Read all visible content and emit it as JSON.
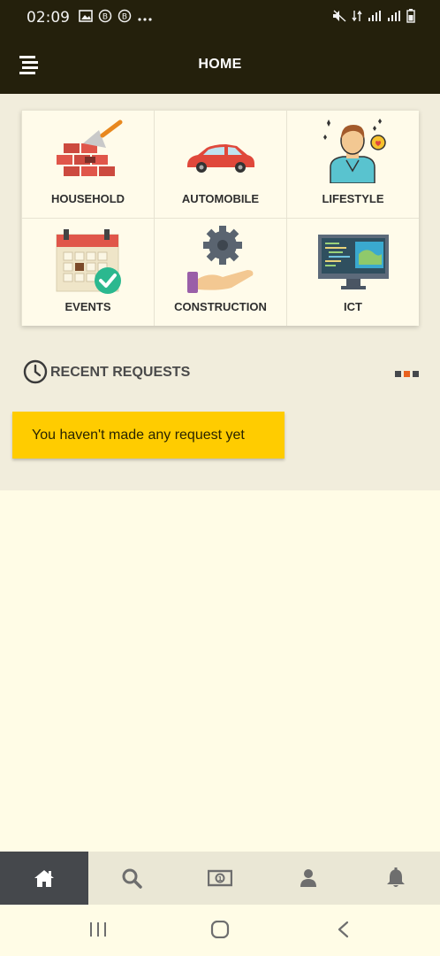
{
  "status_bar": {
    "time": "02:09",
    "left_icons": [
      "gallery-icon",
      "notification-b-icon",
      "notification-b-icon",
      "more-dots-icon"
    ],
    "right_icons": [
      "mute-icon",
      "data-icon",
      "signal-icon",
      "signal-icon",
      "battery-icon"
    ]
  },
  "app_bar": {
    "menu_icon": "menu-icon",
    "title": "HOME"
  },
  "categories": [
    {
      "label": "HOUSEHOLD",
      "icon": "brick-trowel-icon"
    },
    {
      "label": "AUTOMOBILE",
      "icon": "car-icon"
    },
    {
      "label": "LIFESTYLE",
      "icon": "person-icon"
    },
    {
      "label": "EVENTS",
      "icon": "calendar-check-icon"
    },
    {
      "label": "CONSTRUCTION",
      "icon": "gear-hand-icon"
    },
    {
      "label": "ICT",
      "icon": "monitor-code-icon"
    }
  ],
  "recent": {
    "title": "RECENT REQUESTS",
    "icon": "clock-icon",
    "empty_message": "You haven't made any request yet"
  },
  "bottom_tabs": [
    {
      "icon": "home-icon",
      "active": true
    },
    {
      "icon": "search-icon",
      "active": false
    },
    {
      "icon": "money-icon",
      "active": false
    },
    {
      "icon": "user-icon",
      "active": false
    },
    {
      "icon": "bell-icon",
      "active": false
    }
  ],
  "colors": {
    "header_bg": "#24200c",
    "page_bg": "#fffce6",
    "section_bg": "#f1eddc",
    "notice_bg": "#ffcc00",
    "active_tab_bg": "#45484c",
    "dot_accent": "#e8621f"
  }
}
